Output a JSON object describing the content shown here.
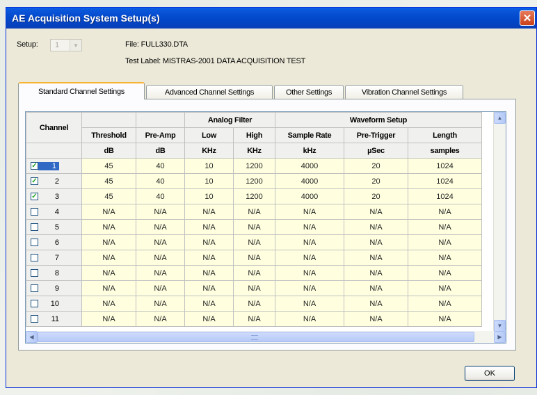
{
  "window": {
    "title": "AE Acquisition System Setup(s)",
    "close_glyph": "✕"
  },
  "setup": {
    "label": "Setup:",
    "value": "1",
    "arrow_glyph": "▼"
  },
  "file": {
    "label": "File: FULL330.DTA"
  },
  "test_label": {
    "label": "Test Label: MISTRAS-2001 DATA ACQUISITION TEST"
  },
  "tabs": [
    {
      "label": "Standard Channel Settings",
      "active": true
    },
    {
      "label": "Advanced Channel Settings",
      "active": false
    },
    {
      "label": "Other Settings",
      "active": false
    },
    {
      "label": "Vibration Channel Settings",
      "active": false
    }
  ],
  "grid": {
    "groups": {
      "analog": "Analog Filter",
      "waveform": "Waveform Setup"
    },
    "headers": {
      "channel": "Channel",
      "threshold": "Threshold",
      "preamp": "Pre-Amp",
      "low": "Low",
      "high": "High",
      "rate": "Sample Rate",
      "pretrig": "Pre-Trigger",
      "length": "Length"
    },
    "units": {
      "threshold": "dB",
      "preamp": "dB",
      "low": "KHz",
      "high": "KHz",
      "rate": "kHz",
      "pretrig": "µSec",
      "length": "samples"
    },
    "rows": [
      {
        "ch": "1",
        "checked": true,
        "selected": true,
        "vals": [
          "45",
          "40",
          "10",
          "1200",
          "4000",
          "20",
          "1024"
        ]
      },
      {
        "ch": "2",
        "checked": true,
        "selected": false,
        "vals": [
          "45",
          "40",
          "10",
          "1200",
          "4000",
          "20",
          "1024"
        ]
      },
      {
        "ch": "3",
        "checked": true,
        "selected": false,
        "vals": [
          "45",
          "40",
          "10",
          "1200",
          "4000",
          "20",
          "1024"
        ]
      },
      {
        "ch": "4",
        "checked": false,
        "selected": false,
        "vals": [
          "N/A",
          "N/A",
          "N/A",
          "N/A",
          "N/A",
          "N/A",
          "N/A"
        ]
      },
      {
        "ch": "5",
        "checked": false,
        "selected": false,
        "vals": [
          "N/A",
          "N/A",
          "N/A",
          "N/A",
          "N/A",
          "N/A",
          "N/A"
        ]
      },
      {
        "ch": "6",
        "checked": false,
        "selected": false,
        "vals": [
          "N/A",
          "N/A",
          "N/A",
          "N/A",
          "N/A",
          "N/A",
          "N/A"
        ]
      },
      {
        "ch": "7",
        "checked": false,
        "selected": false,
        "vals": [
          "N/A",
          "N/A",
          "N/A",
          "N/A",
          "N/A",
          "N/A",
          "N/A"
        ]
      },
      {
        "ch": "8",
        "checked": false,
        "selected": false,
        "vals": [
          "N/A",
          "N/A",
          "N/A",
          "N/A",
          "N/A",
          "N/A",
          "N/A"
        ]
      },
      {
        "ch": "9",
        "checked": false,
        "selected": false,
        "vals": [
          "N/A",
          "N/A",
          "N/A",
          "N/A",
          "N/A",
          "N/A",
          "N/A"
        ]
      },
      {
        "ch": "10",
        "checked": false,
        "selected": false,
        "vals": [
          "N/A",
          "N/A",
          "N/A",
          "N/A",
          "N/A",
          "N/A",
          "N/A"
        ]
      },
      {
        "ch": "11",
        "checked": false,
        "selected": false,
        "vals": [
          "N/A",
          "N/A",
          "N/A",
          "N/A",
          "N/A",
          "N/A",
          "N/A"
        ]
      }
    ]
  },
  "scroll": {
    "up": "▲",
    "down": "▼",
    "left": "◀",
    "right": "▶"
  },
  "ok": {
    "label": "OK"
  },
  "colors": {
    "titlebar": "#0146c8",
    "cell": "#ffffe0",
    "selection": "#316ac5",
    "active_tab": "#f8b234"
  }
}
